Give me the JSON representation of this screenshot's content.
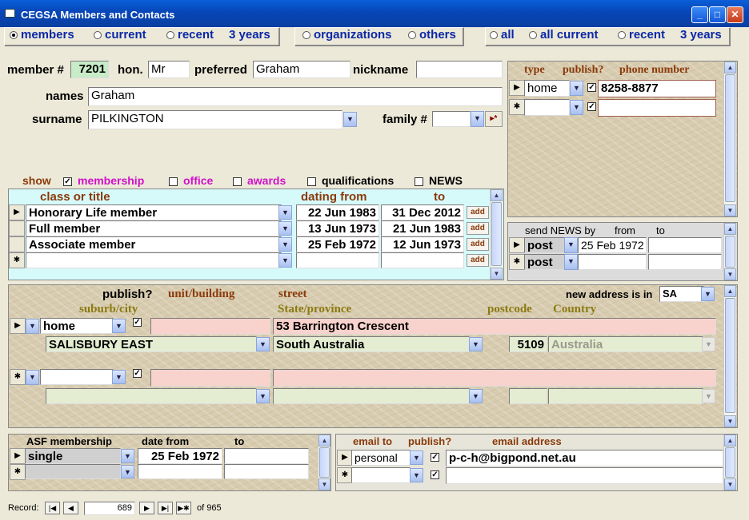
{
  "window": {
    "title": "CEGSA Members and Contacts"
  },
  "filter_members": {
    "members": "members",
    "current": "current",
    "recent": "recent",
    "years": "3 years"
  },
  "filter_orgs": {
    "organizations": "organizations",
    "others": "others"
  },
  "filter_all": {
    "all": "all",
    "all_current": "all current",
    "recent": "recent",
    "years": "3 years"
  },
  "member": {
    "member_label": "member #",
    "member_no": "7201",
    "hon_label": "hon.",
    "hon": "Mr",
    "preferred_label": "preferred",
    "preferred": "Graham",
    "nickname_label": "nickname",
    "nickname": "",
    "names_label": "names",
    "names": "Graham",
    "surname_label": "surname",
    "surname": "PILKINGTON",
    "family_label": "family #",
    "family": "",
    "family_btn": "▸*"
  },
  "show": {
    "label": "show",
    "membership": "membership",
    "office": "office",
    "awards": "awards",
    "qualifications": "qualifications",
    "news": "NEWS"
  },
  "classes": {
    "col_class": "class or title",
    "col_from": "dating from",
    "col_to": "to",
    "add": "add",
    "rows": [
      {
        "title": "Honorary Life member",
        "from": "22 Jun 1983",
        "to": "31 Dec 2012"
      },
      {
        "title": "Full member",
        "from": "13 Jun 1973",
        "to": "21 Jun 1983"
      },
      {
        "title": "Associate member",
        "from": "25 Feb 1972",
        "to": "12 Jun 1973"
      }
    ]
  },
  "phones": {
    "col_type": "type",
    "col_publish": "publish?",
    "col_phone": "phone number",
    "rows": [
      {
        "type": "home",
        "number": "8258-8877"
      }
    ]
  },
  "news": {
    "col_send": "send NEWS by",
    "col_from": "from",
    "col_to": "to",
    "rows": [
      {
        "by": "post",
        "from": "25 Feb 1972",
        "to": ""
      },
      {
        "by": "post",
        "from": "",
        "to": ""
      }
    ]
  },
  "address": {
    "publish": "publish?",
    "unit": "unit/building",
    "street": "street",
    "suburb": "suburb/city",
    "state": "State/province",
    "postcode": "postcode",
    "country": "Country",
    "new_in_label": "new address is in",
    "new_in": "SA",
    "row": {
      "type": "home",
      "unit": "",
      "street": "53 Barrington Crescent",
      "suburb": "SALISBURY EAST",
      "state_val": "South Australia",
      "postcode_val": "5109",
      "country_val": "Australia"
    }
  },
  "asf": {
    "col_m": "ASF membership",
    "col_from": "date from",
    "col_to": "to",
    "rows": [
      {
        "m": "single",
        "from": "25 Feb 1972",
        "to": ""
      }
    ]
  },
  "email": {
    "col_to": "email to",
    "col_publish": "publish?",
    "col_addr": "email address",
    "rows": [
      {
        "to": "personal",
        "addr": "p-c-h@bigpond.net.au"
      }
    ]
  },
  "record": {
    "label": "Record:",
    "current": "689",
    "of": "of  965"
  }
}
